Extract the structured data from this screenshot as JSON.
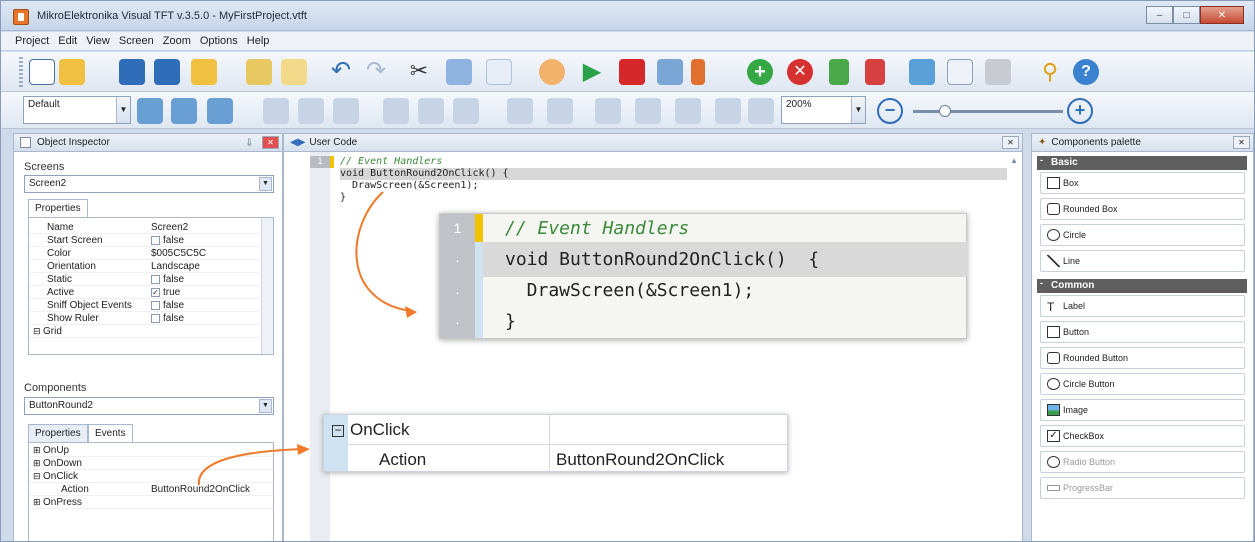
{
  "window": {
    "title": "MikroElektronika Visual TFT v.3.5.0 - MyFirstProject.vtft"
  },
  "menu": [
    "Project",
    "Edit",
    "View",
    "Screen",
    "Zoom",
    "Options",
    "Help"
  ],
  "toolbar2": {
    "style_combo": "Default",
    "zoom_combo": "200%"
  },
  "inspector": {
    "title": "Object Inspector",
    "screens_label": "Screens",
    "screen_value": "Screen2",
    "properties_tab": "Properties",
    "props": [
      {
        "name": "Name",
        "value": "Screen2",
        "check": ""
      },
      {
        "name": "Start Screen",
        "value": "false",
        "check": "off"
      },
      {
        "name": "Color",
        "value": "$005C5C5C",
        "check": ""
      },
      {
        "name": "Orientation",
        "value": "Landscape",
        "check": ""
      },
      {
        "name": "Static",
        "value": "false",
        "check": "off"
      },
      {
        "name": "Active",
        "value": "true",
        "check": "on"
      },
      {
        "name": "Sniff Object Events",
        "value": "false",
        "check": "off"
      },
      {
        "name": "Show Ruler",
        "value": "false",
        "check": "off"
      },
      {
        "name": "Grid",
        "value": "",
        "check": ""
      }
    ],
    "components_label": "Components",
    "component_value": "ButtonRound2",
    "tabs": [
      "Properties",
      "Events"
    ],
    "events": [
      {
        "name": "OnUp",
        "value": ""
      },
      {
        "name": "OnDown",
        "value": ""
      },
      {
        "name": "OnClick",
        "value": ""
      },
      {
        "name": "Action",
        "value": "ButtonRound2OnClick"
      },
      {
        "name": "OnPress",
        "value": ""
      }
    ]
  },
  "editor": {
    "tab": "User Code",
    "lines": [
      "// Event Handlers",
      "void ButtonRound2OnClick() {",
      "  DrawScreen(&Screen1);",
      "}"
    ],
    "gutter": [
      "1"
    ]
  },
  "zoom_code": {
    "num": "1",
    "lines": [
      "// Event Handlers",
      "void ButtonRound2OnClick()  {",
      "  DrawScreen(&Screen1);",
      "}"
    ]
  },
  "zoom_events": {
    "group": "OnClick",
    "name": "Action",
    "value": "ButtonRound2OnClick"
  },
  "palette": {
    "title": "Components palette",
    "groups": [
      "Basic",
      "Common"
    ],
    "basic": [
      "Box",
      "Rounded Box",
      "Circle",
      "Line"
    ],
    "common": [
      "Label",
      "Button",
      "Rounded Button",
      "Circle Button",
      "Image",
      "CheckBox",
      "Radio Button",
      "ProgressBar"
    ]
  },
  "colors": {
    "accent": "#f07a2a",
    "comment": "#3a8a3a"
  }
}
